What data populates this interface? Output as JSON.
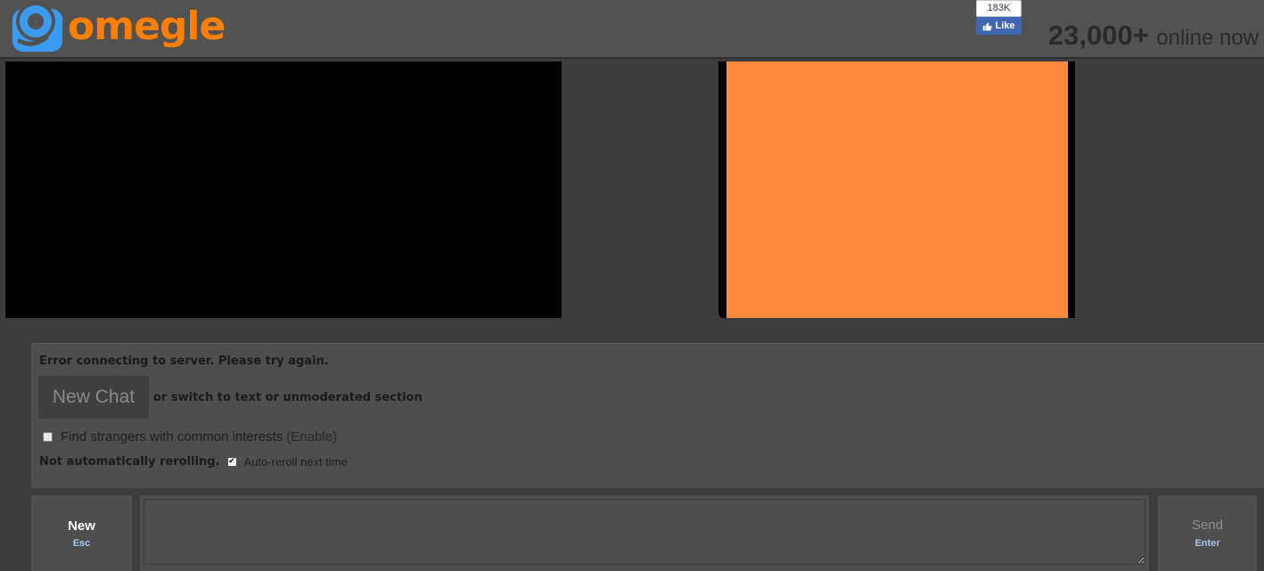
{
  "header": {
    "logo_text": "omegle",
    "fb_count": "183K",
    "fb_like_label": "Like",
    "online_count": "23,000+",
    "online_label": "online now"
  },
  "status": {
    "error_message": "Error connecting to server. Please try again.",
    "new_chat_label": "New Chat",
    "switch_text": "or switch to text or unmoderated section",
    "interests_label": "Find strangers with common interests",
    "enable_label": "(Enable)",
    "reroll_status": "Not automatically rerolling.",
    "auto_reroll_label": "Auto-reroll next time",
    "auto_reroll_checked": true,
    "interests_checked": false
  },
  "controls": {
    "new_label": "New",
    "new_key": "Esc",
    "send_label": "Send",
    "send_key": "Enter",
    "message_value": ""
  },
  "colors": {
    "accent_orange": "#ff7f00",
    "video_placeholder": "#ff893c",
    "fb_blue": "#4267b2",
    "key_hint": "#a9c4ef"
  },
  "icons": {
    "logo": "omegle-logo-icon",
    "like": "thumbs-up-icon",
    "checkmark": "checkmark-icon"
  }
}
